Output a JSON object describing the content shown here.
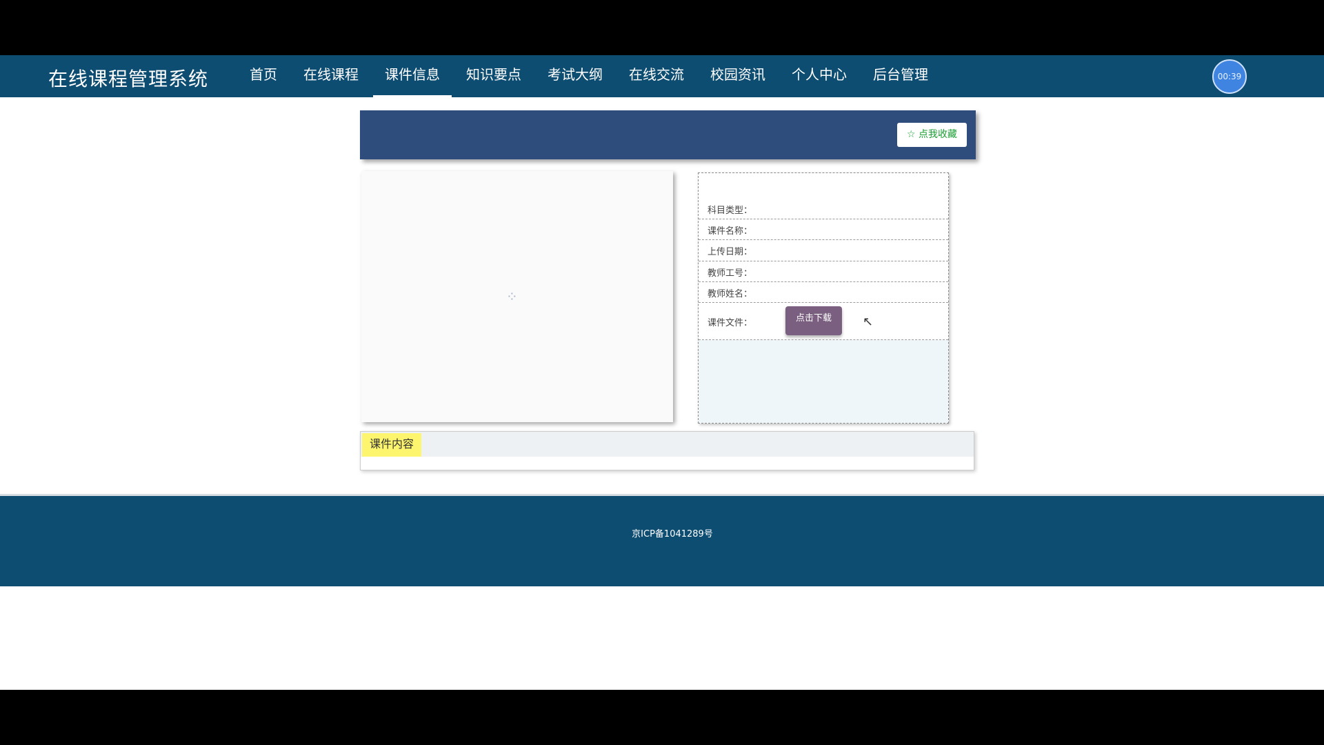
{
  "nav": {
    "title": "在线课程管理系统",
    "items": [
      "首页",
      "在线课程",
      "课件信息",
      "知识要点",
      "考试大纲",
      "在线交流",
      "校园资讯",
      "个人中心",
      "后台管理"
    ],
    "active_index": 2,
    "avatar_text": "00:39"
  },
  "banner": {
    "favorite_label": "☆ 点我收藏"
  },
  "info": {
    "subject_type_label": "科目类型：",
    "courseware_name_label": "课件名称：",
    "upload_date_label": "上传日期：",
    "teacher_id_label": "教师工号：",
    "teacher_name_label": "教师姓名：",
    "courseware_file_label": "课件文件：",
    "download_label": "点击下载"
  },
  "content": {
    "tab_label": "课件内容"
  },
  "footer": {
    "icp": "京ICP备1041289号"
  },
  "colors": {
    "nav_bg": "#0e4d72",
    "banner_bg": "#2e4d7c",
    "download_btn": "#7b5f81",
    "favorite_text": "#1a9f33",
    "content_tag_bg": "#fdf56d"
  }
}
